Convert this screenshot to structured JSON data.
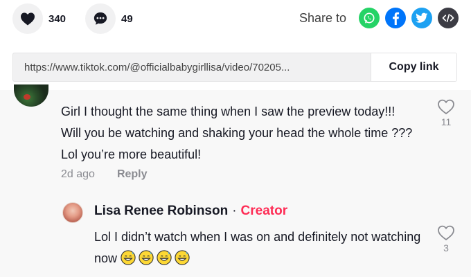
{
  "actions": {
    "likes": "340",
    "comments": "49"
  },
  "share": {
    "label": "Share to",
    "targets": [
      "whatsapp",
      "facebook",
      "twitter",
      "embed"
    ],
    "colors": {
      "whatsapp": "#25d366",
      "facebook": "#0075fa",
      "twitter": "#1da1f2",
      "embed": "#3c3c44"
    }
  },
  "link": {
    "url": "https://www.tiktok.com/@officialbabygirllisa/video/70205...",
    "copy_label": "Copy link"
  },
  "comment": {
    "text": "Girl I thought the same thing when I saw the preview today!!! Will you be watching and shaking your head the whole time ??? Lol you’re more beautiful!",
    "time": "2d ago",
    "reply_label": "Reply",
    "likes": "11"
  },
  "reply": {
    "author": "Lisa Renee Robinson",
    "separator": "·",
    "badge": "Creator",
    "text": "Lol I didn’t watch when I was on and definitely not watching now",
    "emojis": [
      "grinning-sweat-emoji",
      "grinning-sweat-emoji",
      "grinning-sweat-emoji",
      "grinning-sweat-emoji"
    ],
    "likes": "3"
  },
  "colors": {
    "accent": "#fe2c55",
    "muted": "#8a8b91",
    "text": "#161823"
  }
}
